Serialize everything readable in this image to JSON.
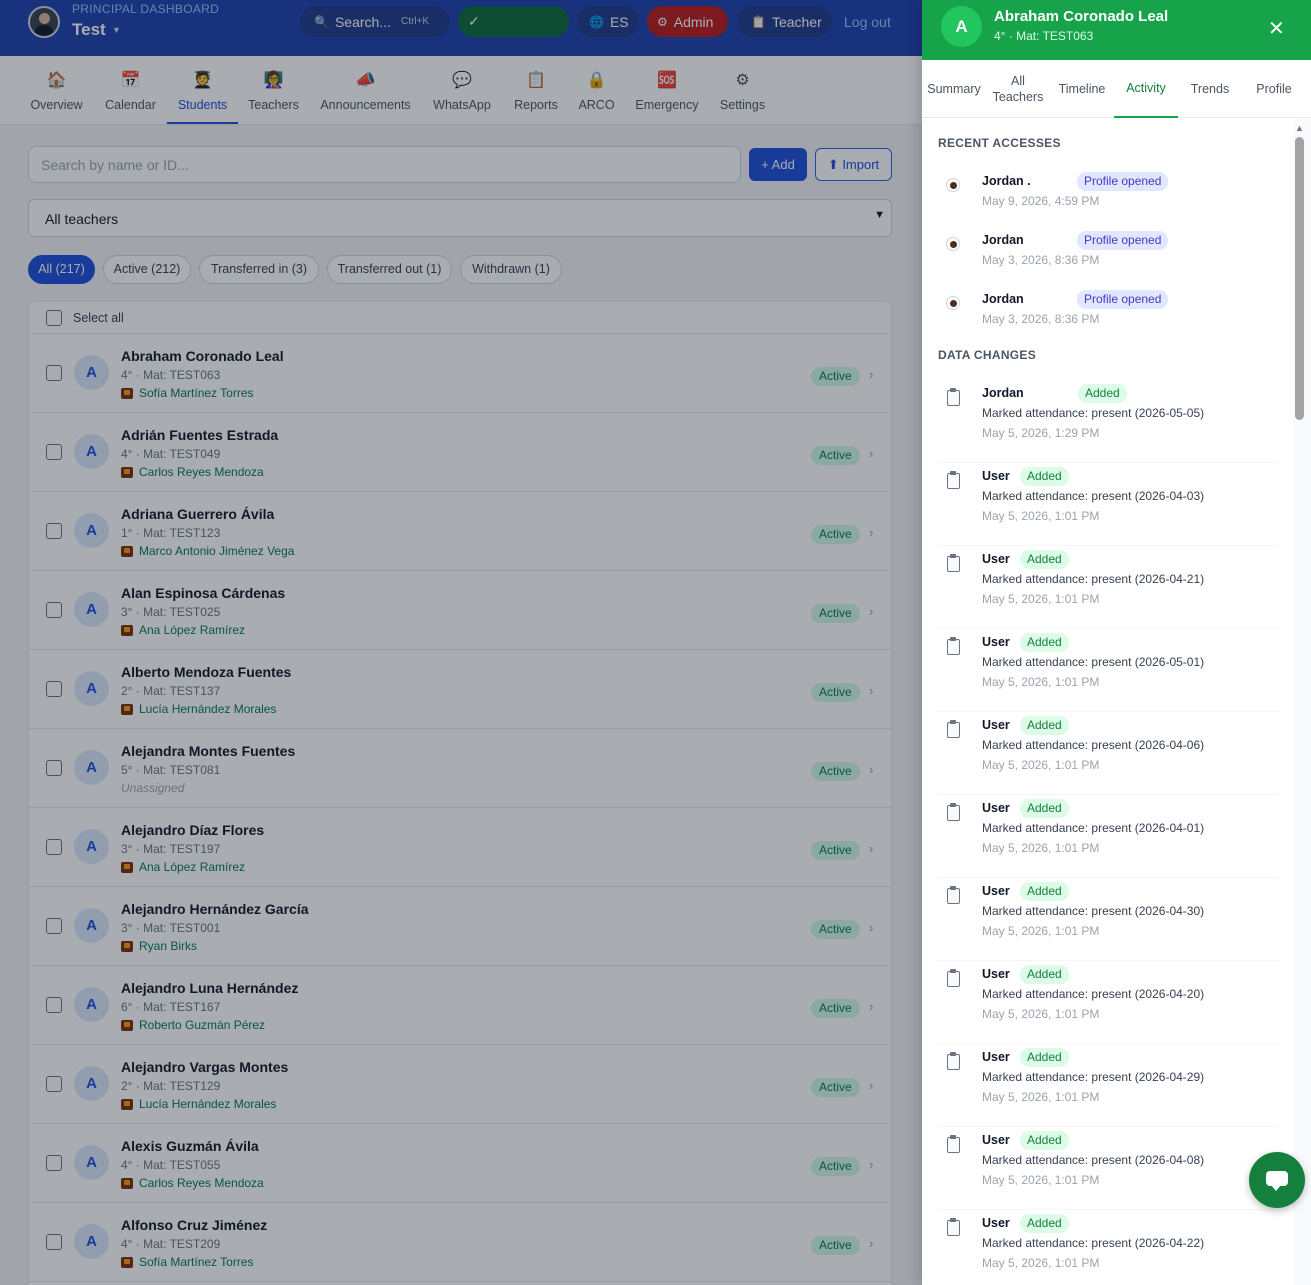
{
  "header": {
    "subtitle": "PRINCIPAL DASHBOARD",
    "school": "Test",
    "search_label": "Search...",
    "search_shortcut": "Ctrl+K",
    "check_label": "✓",
    "lang_label": "ES",
    "admin_label": "Admin",
    "teacher_label": "Teacher",
    "logout_label": "Log out"
  },
  "nav": [
    {
      "label": "Overview",
      "icon": "house-icon"
    },
    {
      "label": "Calendar",
      "icon": "calendar-icon"
    },
    {
      "label": "Students",
      "icon": "student-icon"
    },
    {
      "label": "Teachers",
      "icon": "teacher-icon"
    },
    {
      "label": "Announcements",
      "icon": "megaphone-icon"
    },
    {
      "label": "WhatsApp",
      "icon": "chat-icon"
    },
    {
      "label": "Reports",
      "icon": "clipboard-icon"
    },
    {
      "label": "ARCO",
      "icon": "lock-icon"
    },
    {
      "label": "Emergency",
      "icon": "sos-icon"
    },
    {
      "label": "Settings",
      "icon": "gear-icon"
    }
  ],
  "nav_active": "Students",
  "students": {
    "search_placeholder": "Search by name or ID...",
    "add_label": "+ Add",
    "import_label": "⬆ Import",
    "teacher_filter": "All teachers",
    "chips": [
      "All (217)",
      "Active (212)",
      "Transferred in (3)",
      "Transferred out (1)",
      "Withdrawn (1)"
    ],
    "select_all": "Select all",
    "rows": [
      {
        "initial": "A",
        "name": "Abraham Coronado Leal",
        "meta": "4° · Mat: TEST063",
        "teacher": "Sofía Martínez Torres",
        "status": "Active"
      },
      {
        "initial": "A",
        "name": "Adrián Fuentes Estrada",
        "meta": "4° · Mat: TEST049",
        "teacher": "Carlos Reyes Mendoza",
        "status": "Active"
      },
      {
        "initial": "A",
        "name": "Adriana Guerrero Ávila",
        "meta": "1° · Mat: TEST123",
        "teacher": "Marco Antonio Jiménez Vega",
        "status": "Active"
      },
      {
        "initial": "A",
        "name": "Alan Espinosa Cárdenas",
        "meta": "3° · Mat: TEST025",
        "teacher": "Ana López Ramírez",
        "status": "Active"
      },
      {
        "initial": "A",
        "name": "Alberto Mendoza Fuentes",
        "meta": "2° · Mat: TEST137",
        "teacher": "Lucía Hernández Morales",
        "status": "Active"
      },
      {
        "initial": "A",
        "name": "Alejandra Montes Fuentes",
        "meta": "5° · Mat: TEST081",
        "teacher": "Unassigned",
        "status": "Active"
      },
      {
        "initial": "A",
        "name": "Alejandro Díaz Flores",
        "meta": "3° · Mat: TEST197",
        "teacher": "Ana López Ramírez",
        "status": "Active"
      },
      {
        "initial": "A",
        "name": "Alejandro Hernández García",
        "meta": "3° · Mat: TEST001",
        "teacher": "Ryan Birks",
        "status": "Active"
      },
      {
        "initial": "A",
        "name": "Alejandro Luna Hernández",
        "meta": "6° · Mat: TEST167",
        "teacher": "Roberto Guzmán Pérez",
        "status": "Active"
      },
      {
        "initial": "A",
        "name": "Alejandro Vargas Montes",
        "meta": "2° · Mat: TEST129",
        "teacher": "Lucía Hernández Morales",
        "status": "Active"
      },
      {
        "initial": "A",
        "name": "Alexis Guzmán Ávila",
        "meta": "4° · Mat: TEST055",
        "teacher": "Carlos Reyes Mendoza",
        "status": "Active"
      },
      {
        "initial": "A",
        "name": "Alfonso Cruz Jiménez",
        "meta": "4° · Mat: TEST209",
        "teacher": "Sofía Martínez Torres",
        "status": "Active"
      }
    ]
  },
  "panel": {
    "initial": "A",
    "name": "Abraham Coronado Leal",
    "meta": "4° · Mat: TEST063",
    "close": "✕",
    "tabs": [
      "Summary",
      "All Teachers",
      "Timeline",
      "Activity",
      "Trends",
      "Profile"
    ],
    "active_tab": "Activity",
    "recent_title": "RECENT ACCESSES",
    "accesses": [
      {
        "user": "Jordan .",
        "action": "Profile opened",
        "date": "May 9, 2026, 4:59 PM"
      },
      {
        "user": "Jordan",
        "action": "Profile opened",
        "date": "May 3, 2026, 8:36 PM"
      },
      {
        "user": "Jordan",
        "action": "Profile opened",
        "date": "May 3, 2026, 8:36 PM"
      }
    ],
    "changes_title": "DATA CHANGES",
    "changes": [
      {
        "user": "Jordan",
        "action": "Added",
        "desc": "Marked attendance: present (2026-05-05)",
        "date": "May 5, 2026, 1:29 PM"
      },
      {
        "user": "User",
        "action": "Added",
        "desc": "Marked attendance: present (2026-04-03)",
        "date": "May 5, 2026, 1:01 PM"
      },
      {
        "user": "User",
        "action": "Added",
        "desc": "Marked attendance: present (2026-04-21)",
        "date": "May 5, 2026, 1:01 PM"
      },
      {
        "user": "User",
        "action": "Added",
        "desc": "Marked attendance: present (2026-05-01)",
        "date": "May 5, 2026, 1:01 PM"
      },
      {
        "user": "User",
        "action": "Added",
        "desc": "Marked attendance: present (2026-04-06)",
        "date": "May 5, 2026, 1:01 PM"
      },
      {
        "user": "User",
        "action": "Added",
        "desc": "Marked attendance: present (2026-04-01)",
        "date": "May 5, 2026, 1:01 PM"
      },
      {
        "user": "User",
        "action": "Added",
        "desc": "Marked attendance: present (2026-04-30)",
        "date": "May 5, 2026, 1:01 PM"
      },
      {
        "user": "User",
        "action": "Added",
        "desc": "Marked attendance: present (2026-04-20)",
        "date": "May 5, 2026, 1:01 PM"
      },
      {
        "user": "User",
        "action": "Added",
        "desc": "Marked attendance: present (2026-04-29)",
        "date": "May 5, 2026, 1:01 PM"
      },
      {
        "user": "User",
        "action": "Added",
        "desc": "Marked attendance: present (2026-04-08)",
        "date": "May 5, 2026, 1:01 PM"
      },
      {
        "user": "User",
        "action": "Added",
        "desc": "Marked attendance: present (2026-04-22)",
        "date": "May 5, 2026, 1:01 PM"
      }
    ]
  },
  "colors": {
    "primary": "#1e40af",
    "accent": "#16a34a",
    "danger": "#b91c1c"
  }
}
